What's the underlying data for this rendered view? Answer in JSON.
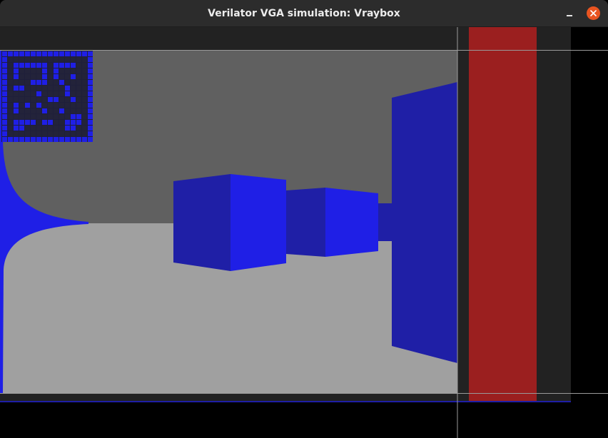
{
  "window": {
    "title": "Verilator VGA simulation: Vraybox",
    "controls": {
      "minimize_icon": "minimize-icon",
      "close_icon": "close-icon"
    }
  },
  "scene": {
    "ceiling_color": "#606060",
    "floor_color": "#a0a0a0",
    "wall_light": "#1f1fe6",
    "wall_dark": "#1f1fa6",
    "border_color": "#222222",
    "overlay_bar_color": "#9b1f1f",
    "guide_line_color": "#9a9a9a"
  },
  "minimap": {
    "grid": [
      "1111111111111111",
      "1000000000000001",
      "1011111101111001",
      "1010000101000001",
      "1010000101001001",
      "1000011100100001",
      "1011000000010001",
      "1000001000010001",
      "1000000011001001",
      "1010101000000001",
      "1010000100100001",
      "1000000000001101",
      "1011110110011101",
      "1011000000011001",
      "1000000000000001",
      "1111111111111111"
    ]
  }
}
